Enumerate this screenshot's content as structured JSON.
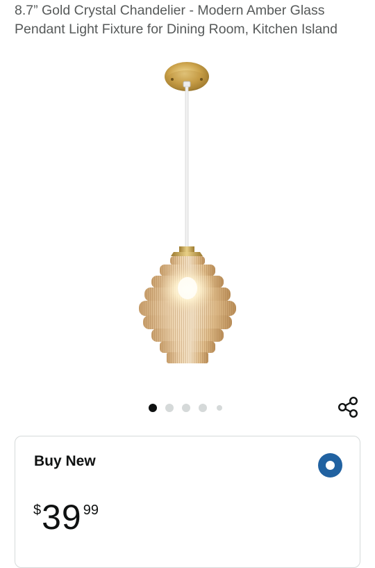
{
  "product": {
    "title": "8.7” Gold Crystal Chandelier - Modern Amber Glass Pendant Light Fixture for Dining Room, Kitchen Island"
  },
  "image": {
    "icon": "pendant-light-product-image"
  },
  "carousel": {
    "count": 5,
    "active_index": 0
  },
  "share": {
    "icon": "share-icon"
  },
  "buy_box": {
    "label": "Buy New",
    "selected": true,
    "price": {
      "symbol": "$",
      "whole": "39",
      "fraction": "99"
    }
  },
  "colors": {
    "accent_radio": "#2162a1",
    "title_text": "#565959",
    "border": "#d5d9d9",
    "gold": "#c9a24a",
    "amber_glass": "#e2c49b"
  }
}
